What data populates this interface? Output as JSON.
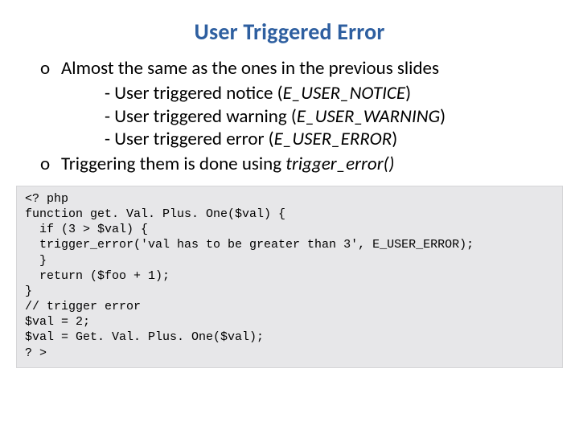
{
  "title": "User Triggered Error",
  "bullets": {
    "b1": {
      "marker": "o",
      "text": "Almost the same as the ones in the previous slides"
    },
    "sub1_prefix": "- User triggered notice (",
    "sub1_const": "E_USER_NOTICE",
    "sub1_suffix": ")",
    "sub2_prefix": "- User triggered warning (",
    "sub2_const": "E_USER_WARNING",
    "sub2_suffix": ")",
    "sub3_prefix": "- User triggered error (",
    "sub3_const": "E_USER_ERROR",
    "sub3_suffix": ")",
    "b2": {
      "marker": "o",
      "text_prefix": "Triggering them is done using ",
      "fn": "trigger_error()"
    }
  },
  "code": "<? php\nfunction get. Val. Plus. One($val) {\n  if (3 > $val) {\n  trigger_error('val has to be greater than 3', E_USER_ERROR);\n  }\n  return ($foo + 1);\n}\n// trigger error\n$val = 2;\n$val = Get. Val. Plus. One($val);\n? >"
}
